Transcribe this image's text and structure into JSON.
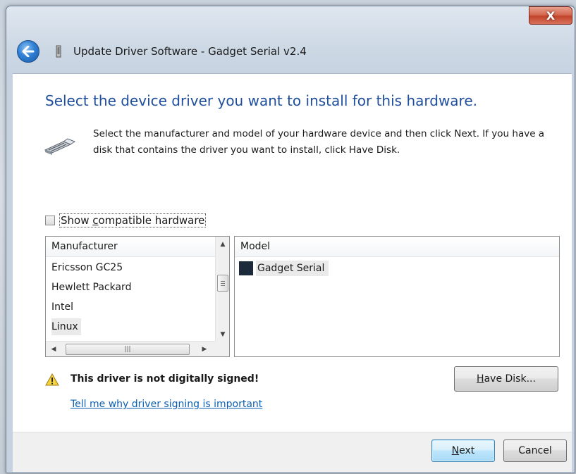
{
  "window": {
    "title": "Update Driver Software - Gadget Serial v2.4",
    "close_label": "X"
  },
  "content": {
    "heading": "Select the device driver you want to install for this hardware.",
    "description": "Select the manufacturer and model of your hardware device and then click Next. If you have a disk that contains the driver you want to install, click Have Disk."
  },
  "compatible": {
    "label_prefix": "Show ",
    "label_accel": "c",
    "label_rest": "ompatible hardware",
    "checked": false
  },
  "manufacturer_list": {
    "header": "Manufacturer",
    "items": [
      "Ericsson GC25",
      "Hewlett Packard",
      "Intel",
      "Linux"
    ],
    "selected": "Linux"
  },
  "model_list": {
    "header": "Model",
    "items": [
      "Gadget Serial"
    ],
    "selected": "Gadget Serial"
  },
  "warning": {
    "text": "This driver is not digitally signed!",
    "link": "Tell me why driver signing is important"
  },
  "buttons": {
    "have_disk_accel": "H",
    "have_disk_rest": "ave Disk...",
    "next_accel": "N",
    "next_rest": "ext",
    "cancel": "Cancel"
  },
  "colors": {
    "heading": "#1f4e9c",
    "link": "#0c5fb3",
    "close_button": "#c2452b",
    "next_button": "#bee6fd"
  }
}
